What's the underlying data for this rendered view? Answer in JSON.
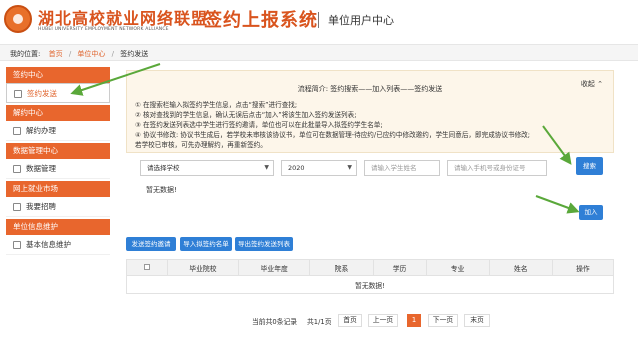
{
  "header": {
    "org_name": "湖北高校就业网络联盟",
    "org_en": "HUBEI UNIVERSITY EMPLOYMENT NETWORK ALLIANCE",
    "system_title": "签约上报系统",
    "user_center": "单位用户中心"
  },
  "breadcrumb": {
    "label": "我的位置:",
    "items": [
      "首页",
      "单位中心",
      "签约发送"
    ]
  },
  "sidebar": {
    "sections": [
      {
        "title": "签约中心",
        "items": [
          "签约发送"
        ]
      },
      {
        "title": "解约中心",
        "items": [
          "解约办理"
        ]
      },
      {
        "title": "数据管理中心",
        "items": [
          "数据管理"
        ]
      },
      {
        "title": "网上就业市场",
        "items": [
          "我要招聘"
        ]
      },
      {
        "title": "单位信息维护",
        "items": [
          "基本信息维护"
        ]
      }
    ]
  },
  "panel": {
    "flow": "流程简介: 签约搜索——加入列表——签约发送",
    "collapse": "收起",
    "instructions": [
      "① 在搜索栏输入拟签约学生信息，点击“搜索”进行查找;",
      "② 核对查找到的学生信息，确认无误后点击“加入”将该生加入签约发送列表;",
      "③ 在签约发送列表选中学生进行签约邀请，单位也可以在此批量导入拟签约学生名单;",
      "④ 协议书修改: 协议书生成后，若学校未审核该协议书，单位可在数据管理-待应约/已应约中修改邀约，学生同意后，即完成协议书修改;",
      "若学校已审核，可先办理解约，再重新签约。"
    ]
  },
  "filters": {
    "school": "请选择学校",
    "year": "2020",
    "name_placeholder": "请输入学生姓名",
    "id_placeholder": "请输入手机号或身份证号",
    "search": "搜索",
    "add": "加入",
    "no_data": "暂无数据!"
  },
  "actions": {
    "send_invite": "发送签约邀请",
    "import": "导入拟签约名单",
    "export": "导出签约发送列表"
  },
  "table": {
    "columns": [
      "",
      "毕业院校",
      "毕业年度",
      "院系",
      "学历",
      "专业",
      "姓名",
      "操作"
    ],
    "empty": "暂无数据!"
  },
  "pagination": {
    "summary": "当前共0条记录",
    "pages": "共1/1页",
    "first": "首页",
    "prev": "上一页",
    "current": "1",
    "next": "下一页",
    "last": "末页"
  }
}
